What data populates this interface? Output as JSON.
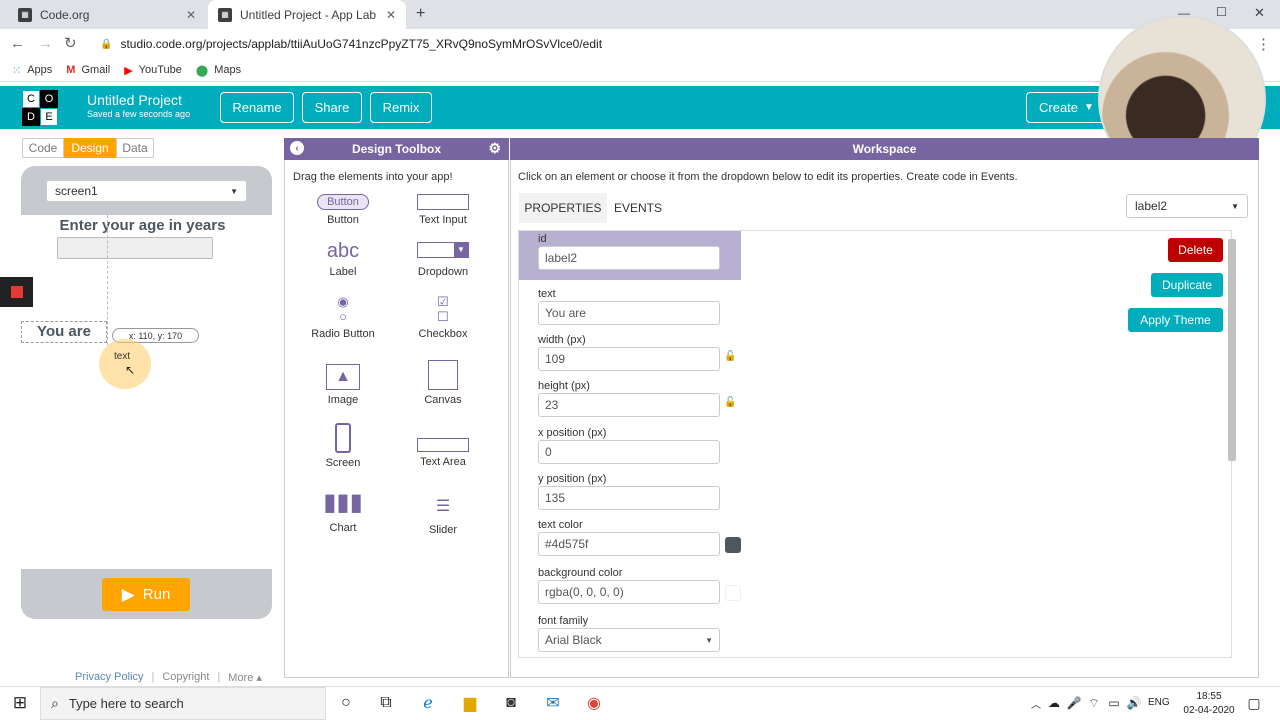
{
  "browser": {
    "tabs": [
      {
        "title": "Code.org"
      },
      {
        "title": "Untitled Project - App Lab"
      }
    ],
    "url": "studio.code.org/projects/applab/ttiiAuUoG741nzcPpyZT75_XRvQ9noSymMrOSvVlce0/edit",
    "bookmarks": [
      "Apps",
      "Gmail",
      "YouTube",
      "Maps"
    ]
  },
  "header": {
    "logo_letters": [
      "C",
      "O",
      "D",
      "E"
    ],
    "project_title": "Untitled Project",
    "saved_status": "Saved a few seconds ago",
    "rename_label": "Rename",
    "share_label": "Share",
    "remix_label": "Remix",
    "create_label": "Create"
  },
  "left_panel": {
    "tabs": [
      "Code",
      "Design",
      "Data"
    ],
    "screen_select": "screen1",
    "age_label": "Enter your age in years",
    "you_are_label": "You are",
    "drag_tooltip": "x: 110, y: 170",
    "drag_element": "text",
    "run_label": "Run"
  },
  "toolbox": {
    "title": "Design Toolbox",
    "hint": "Drag the elements into your app!",
    "button_preview": "Button",
    "label_preview": "abc",
    "items": [
      "Button",
      "Text Input",
      "Label",
      "Dropdown",
      "Radio Button",
      "Checkbox",
      "Image",
      "Canvas",
      "Screen",
      "Text Area",
      "Chart",
      "Slider"
    ]
  },
  "workspace": {
    "title": "Workspace",
    "instructions": "Click on an element or choose it from the dropdown below to edit its properties. Create code in Events.",
    "tab_properties": "PROPERTIES",
    "tab_events": "EVENTS",
    "element_select": "label2",
    "delete_label": "Delete",
    "duplicate_label": "Duplicate",
    "apply_theme_label": "Apply Theme",
    "props": {
      "id_label": "id",
      "id_value": "label2",
      "text_label": "text",
      "text_value": "You are",
      "width_label": "width (px)",
      "width_value": "109",
      "height_label": "height (px)",
      "height_value": "23",
      "x_label": "x position (px)",
      "x_value": "0",
      "y_label": "y position (px)",
      "y_value": "135",
      "text_color_label": "text color",
      "text_color_value": "#4d575f",
      "bg_color_label": "background color",
      "bg_color_value": "rgba(0, 0, 0, 0)",
      "font_family_label": "font family",
      "font_family_value": "Arial Black"
    }
  },
  "footer": {
    "privacy": "Privacy Policy",
    "copyright": "Copyright",
    "more": "More"
  },
  "taskbar": {
    "search_placeholder": "Type here to search",
    "language": "ENG",
    "time": "18:55",
    "date": "02-04-2020"
  },
  "colors": {
    "brand_teal": "#00adbc",
    "purple": "#7665a0",
    "orange": "#ffa400",
    "delete_red": "#c00000",
    "text_color_swatch": "#4d575f"
  }
}
